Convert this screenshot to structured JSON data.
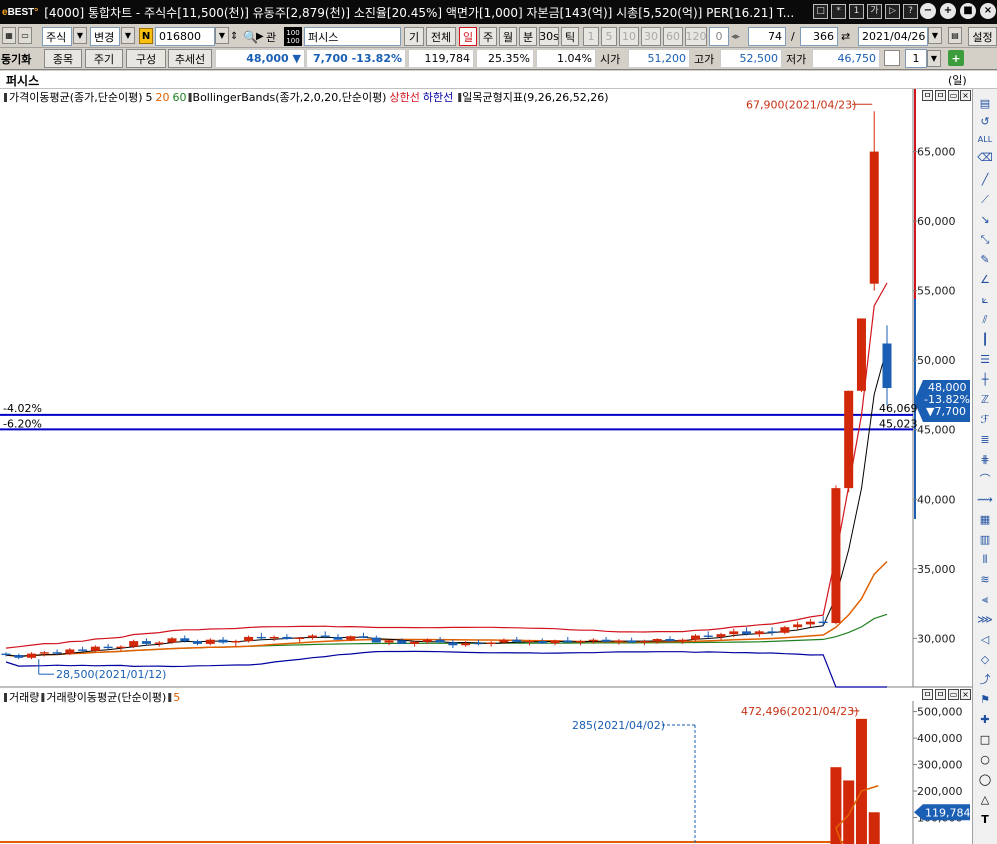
{
  "window": {
    "logo": "eBEST",
    "title": "[4000] 통합차트 - 주식수[11,500(천)] 유동주[2,879(천)] 소진율[20.45%] 액면가[1,000] 자본금[143(억)] 시총[5,520(억)] PER[16.21] T..."
  },
  "toolbar1": {
    "market": "주식",
    "change_btn": "변경",
    "badge": "N",
    "code": "016800",
    "gwan_btn": "관",
    "stock_name": "퍼시스",
    "gi_btn": "기",
    "all_btn": "전체",
    "periods": [
      "일",
      "주",
      "월",
      "분",
      "30s",
      "틱"
    ],
    "active_period": "일",
    "nums": [
      "1",
      "5",
      "10",
      "30",
      "60",
      "120"
    ],
    "counter_a": "0",
    "count": "74",
    "slash": "/",
    "total": "366",
    "date": "2021/04/26",
    "settings": "설정"
  },
  "toolbar2": {
    "sync_label": "동기화",
    "tabs": [
      "종목",
      "주기",
      "구성",
      "추세선"
    ],
    "price": "48,000",
    "change": "7,700",
    "pct": "-13.82%",
    "volume": "119,784",
    "turnover": "25.35%",
    "ratio": "1.04%",
    "open_label": "시가",
    "open": "51,200",
    "high_label": "고가",
    "high": "52,500",
    "low_label": "저가",
    "low": "46,750",
    "spin": "1"
  },
  "header": {
    "name": "퍼시스",
    "unit": "(일)"
  },
  "price_panel": {
    "legend": [
      {
        "text": "가격이동평균(종가,단순이평)",
        "color": "#000000"
      },
      {
        "text": "5",
        "color": "#000000"
      },
      {
        "text": "20",
        "color": "#e06000"
      },
      {
        "text": "60",
        "color": "#208020"
      },
      {
        "text": "BollingerBands(종가,2,0,20,단순이평)",
        "color": "#000000"
      },
      {
        "text": "상한선",
        "color": "#d2141e"
      },
      {
        "text": "하한선",
        "color": "#0000a0"
      },
      {
        "text": "일목균형지표(9,26,26,52,26)",
        "color": "#000000"
      }
    ],
    "ticks": [
      "65,000",
      "60,000",
      "55,000",
      "50,000",
      "45,000",
      "40,000",
      "35,000",
      "30,000"
    ],
    "max_label": "67,900(2021/04/23)",
    "min_label": "28,500(2021/01/12)",
    "hline1_pct": "-4.02%",
    "hline1_val": "46,069",
    "hline2_pct": "-6.20%",
    "hline2_val": "45,023",
    "cur_price": "48,000",
    "cur_change": "-13.82%",
    "cur_diff": "▼7,700"
  },
  "volume_panel": {
    "legend": [
      {
        "text": "거래량",
        "color": "#000000"
      },
      {
        "text": "거래량이동평균(단순이평)",
        "color": "#000000"
      },
      {
        "text": "5",
        "color": "#e06000"
      }
    ],
    "ticks": [
      "500,000",
      "400,000",
      "300,000",
      "200,000",
      "100,000"
    ],
    "max_label": "472,496(2021/04/23)",
    "min_label": "285(2021/04/02)",
    "cur": "119,784"
  },
  "colors": {
    "up": "#d2280a",
    "down": "#1a5fb4",
    "ma5": "#000000",
    "ma20": "#e06000",
    "ma60": "#208020",
    "bb_up": "#d2141e",
    "bb_dn": "#0000a0",
    "hline": "#0000c8"
  },
  "chart_data": {
    "type": "candlestick",
    "title": "퍼시스",
    "ylim": [
      26500,
      69500
    ],
    "candles": [
      [
        28900,
        29000,
        28700,
        28800
      ],
      [
        28800,
        28900,
        28500,
        28600
      ],
      [
        28600,
        29000,
        28500,
        28900
      ],
      [
        28900,
        29100,
        28700,
        29000
      ],
      [
        29000,
        29200,
        28800,
        28900
      ],
      [
        28900,
        29300,
        28800,
        29200
      ],
      [
        29200,
        29400,
        29000,
        29100
      ],
      [
        29100,
        29500,
        29000,
        29400
      ],
      [
        29400,
        29600,
        29200,
        29300
      ],
      [
        29300,
        29500,
        29100,
        29400
      ],
      [
        29400,
        29900,
        29300,
        29800
      ],
      [
        29800,
        30000,
        29500,
        29600
      ],
      [
        29600,
        29800,
        29400,
        29700
      ],
      [
        29700,
        30100,
        29600,
        30000
      ],
      [
        30000,
        30200,
        29700,
        29800
      ],
      [
        29800,
        29900,
        29500,
        29600
      ],
      [
        29600,
        30000,
        29500,
        29900
      ],
      [
        29900,
        30100,
        29600,
        29700
      ],
      [
        29700,
        29900,
        29400,
        29800
      ],
      [
        29800,
        30200,
        29700,
        30100
      ],
      [
        30100,
        30400,
        29900,
        30000
      ],
      [
        30000,
        30200,
        29800,
        30100
      ],
      [
        30100,
        30300,
        29900,
        29950
      ],
      [
        29950,
        30100,
        29700,
        30050
      ],
      [
        30050,
        30300,
        29900,
        30200
      ],
      [
        30200,
        30500,
        30000,
        30100
      ],
      [
        30100,
        30300,
        29900,
        29900
      ],
      [
        29900,
        30200,
        29800,
        30150
      ],
      [
        30150,
        30400,
        30000,
        30050
      ],
      [
        30050,
        30200,
        29800,
        29700
      ],
      [
        29700,
        29900,
        29500,
        29850
      ],
      [
        29850,
        30000,
        29600,
        29600
      ],
      [
        29600,
        29800,
        29400,
        29750
      ],
      [
        29750,
        30000,
        29600,
        29900
      ],
      [
        29900,
        30100,
        29700,
        29700
      ],
      [
        29700,
        29900,
        29300,
        29500
      ],
      [
        29500,
        29800,
        29400,
        29650
      ],
      [
        29650,
        29900,
        29500,
        29600
      ],
      [
        29600,
        29800,
        29400,
        29700
      ],
      [
        29700,
        30000,
        29600,
        29900
      ],
      [
        29900,
        30100,
        29700,
        29750
      ],
      [
        29750,
        29900,
        29500,
        29800
      ],
      [
        29800,
        30000,
        29600,
        29650
      ],
      [
        29650,
        29900,
        29500,
        29850
      ],
      [
        29850,
        30100,
        29700,
        29700
      ],
      [
        29700,
        29900,
        29500,
        29800
      ],
      [
        29800,
        30000,
        29600,
        29900
      ],
      [
        29900,
        30100,
        29700,
        29750
      ],
      [
        29750,
        29950,
        29550,
        29850
      ],
      [
        29850,
        30050,
        29650,
        29700
      ],
      [
        29700,
        29900,
        29500,
        29800
      ],
      [
        29800,
        30000,
        29600,
        29950
      ],
      [
        29950,
        30150,
        29750,
        29800
      ],
      [
        29800,
        30000,
        29600,
        29900
      ],
      [
        29900,
        30300,
        29800,
        30200
      ],
      [
        30200,
        30500,
        30000,
        30100
      ],
      [
        30100,
        30400,
        29900,
        30300
      ],
      [
        30300,
        30700,
        30100,
        30500
      ],
      [
        30500,
        30800,
        30200,
        30300
      ],
      [
        30300,
        30600,
        30100,
        30500
      ],
      [
        30500,
        30800,
        30200,
        30400
      ],
      [
        30400,
        30900,
        30300,
        30800
      ],
      [
        30800,
        31200,
        30600,
        31000
      ],
      [
        31000,
        31400,
        30800,
        31200
      ],
      [
        31200,
        31600,
        30900,
        31100
      ],
      [
        31100,
        41000,
        31000,
        40800
      ],
      [
        40800,
        47800,
        40500,
        47800
      ],
      [
        47800,
        53000,
        47700,
        53000
      ],
      [
        55500,
        67900,
        55000,
        65000
      ],
      [
        51200,
        52500,
        46750,
        48000
      ]
    ],
    "volume_max": 540000,
    "volume_tail": [
      {
        "index": 65,
        "value": 290000
      },
      {
        "index": 66,
        "value": 240000
      },
      {
        "index": 67,
        "value": 472496
      },
      {
        "index": 68,
        "value": 119784
      }
    ]
  }
}
